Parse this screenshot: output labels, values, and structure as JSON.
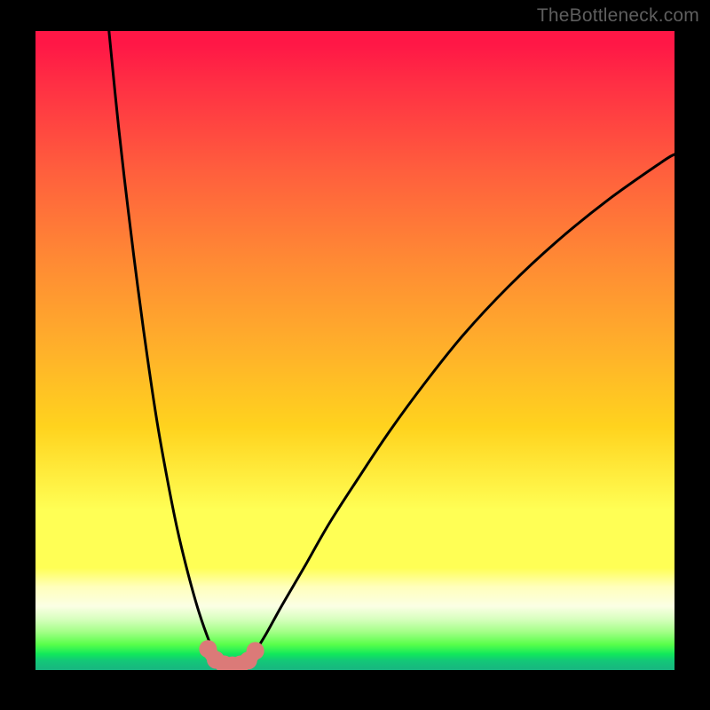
{
  "page": {
    "watermark": "TheBottleneck.com"
  },
  "chart_data": {
    "type": "line",
    "title": "",
    "xlabel": "",
    "ylabel": "",
    "x_range": [
      0,
      100
    ],
    "y_range": [
      0,
      100
    ],
    "series": [
      {
        "name": "curve-left",
        "stroke": "#000000",
        "x": [
          11.5,
          13.0,
          14.5,
          16.0,
          17.5,
          19.0,
          20.6,
          22.2,
          23.9,
          25.6,
          27.3,
          28.2
        ],
        "y": [
          100.0,
          85.0,
          72.0,
          60.0,
          49.0,
          39.0,
          30.0,
          22.0,
          15.0,
          9.0,
          4.2,
          2.3
        ]
      },
      {
        "name": "curve-right",
        "stroke": "#000000",
        "x": [
          34.0,
          36.0,
          38.5,
          42.0,
          46.0,
          50.5,
          55.5,
          61.0,
          67.0,
          74.0,
          81.5,
          89.5,
          98.0,
          100.0
        ],
        "y": [
          2.3,
          5.5,
          10.0,
          16.0,
          23.0,
          30.0,
          37.5,
          45.0,
          52.5,
          60.0,
          67.0,
          73.5,
          79.5,
          80.7
        ]
      },
      {
        "name": "bottom-arc",
        "stroke": "#db7a78",
        "stroke_width_px": 16,
        "markers": true,
        "x": [
          27.0,
          28.2,
          29.5,
          30.8,
          32.1,
          33.3,
          34.4
        ],
        "y": [
          3.3,
          1.6,
          0.9,
          0.75,
          0.9,
          1.5,
          3.0
        ]
      }
    ],
    "background": {
      "type": "vertical-gradient",
      "stops": [
        {
          "pos": 0.0,
          "color": "#ff1746"
        },
        {
          "pos": 0.84,
          "color": "#ffff55"
        },
        {
          "pos": 1.0,
          "color": "#18b580"
        }
      ]
    }
  }
}
